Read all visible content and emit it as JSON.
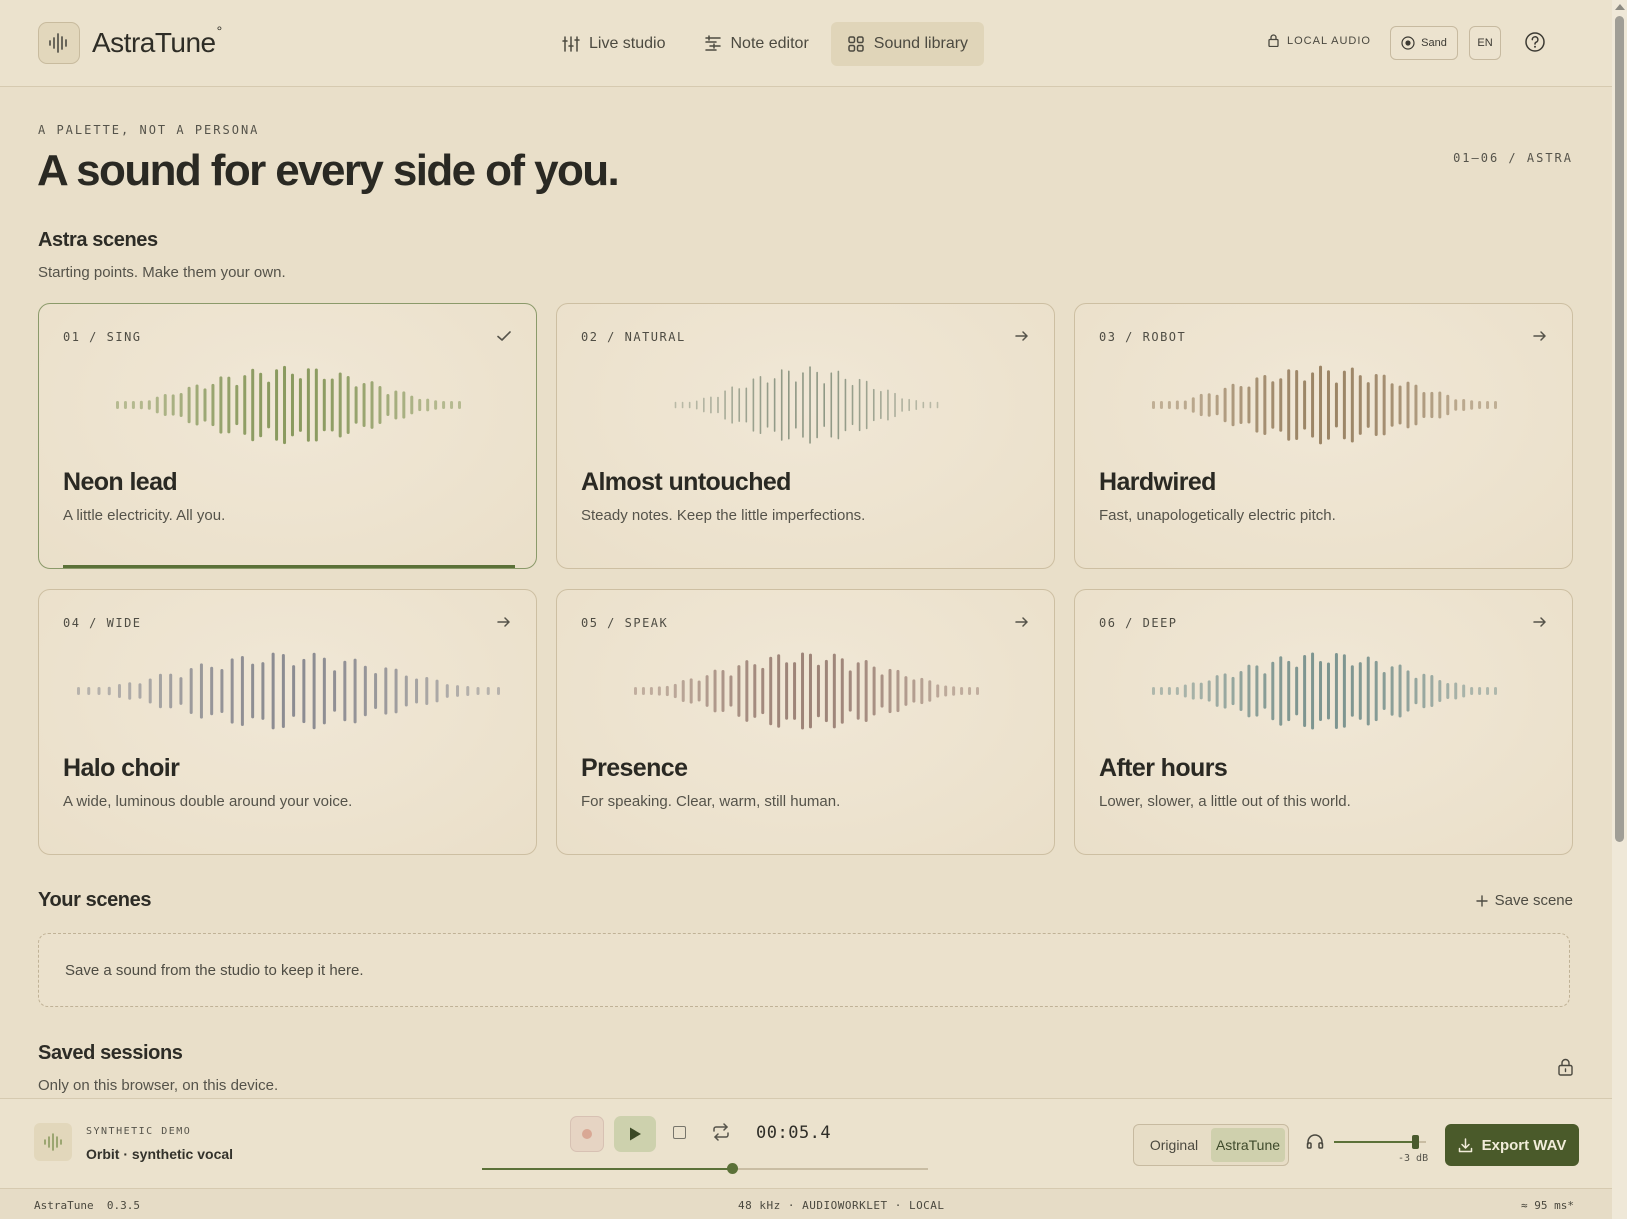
{
  "app": {
    "name": "AstraTune",
    "name_mark": "°"
  },
  "nav": [
    {
      "label": "Live studio",
      "icon": "sliders-icon",
      "active": false
    },
    {
      "label": "Note editor",
      "icon": "note-list-icon",
      "active": false
    },
    {
      "label": "Sound library",
      "icon": "grid-icon",
      "active": true
    }
  ],
  "topbar": {
    "local_audio": "LOCAL AUDIO",
    "theme_label": "Sand",
    "lang_label": "EN"
  },
  "hero": {
    "eyebrow": "A PALETTE, NOT A PERSONA",
    "title": "A sound for every side of you.",
    "index": "01—06 / ASTRA"
  },
  "astra_scenes": {
    "title": "Astra scenes",
    "subtitle": "Starting points. Make them your own."
  },
  "cards": [
    {
      "tag": "01 / SING",
      "title": "Neon lead",
      "desc": "A little electricity. All you.",
      "selected": true,
      "color": "#8a9a5f",
      "shape": 1
    },
    {
      "tag": "02 / NATURAL",
      "title": "Almost untouched",
      "desc": "Steady notes. Keep the little imperfections.",
      "selected": false,
      "color": "#8e9784",
      "shape": 2
    },
    {
      "tag": "03 / ROBOT",
      "title": "Hardwired",
      "desc": "Fast, unapologetically electric pitch.",
      "selected": false,
      "color": "#9c8566",
      "shape": 1
    },
    {
      "tag": "04 / WIDE",
      "title": "Halo choir",
      "desc": "A wide, luminous double around your voice.",
      "selected": false,
      "color": "#8c8c92",
      "shape": 3
    },
    {
      "tag": "05 / SPEAK",
      "title": "Presence",
      "desc": "For speaking. Clear, warm, still human.",
      "selected": false,
      "color": "#9e8478",
      "shape": 1
    },
    {
      "tag": "06 / DEEP",
      "title": "After hours",
      "desc": "Lower, slower, a little out of this world.",
      "selected": false,
      "color": "#7d9590",
      "shape": 1
    }
  ],
  "your_scenes": {
    "title": "Your scenes",
    "save_label": "Save scene",
    "empty": "Save a sound from the studio to keep it here."
  },
  "saved_sessions": {
    "title": "Saved sessions",
    "subtitle": "Only on this browser, on this device."
  },
  "player": {
    "source_label": "SYNTHETIC DEMO",
    "track": "Orbit · synthetic vocal",
    "time": "00:05.4",
    "progress": 0.56,
    "ab_original": "Original",
    "ab_processed": "AstraTune",
    "ab_selected": "AstraTune",
    "volume": 0.88,
    "volume_label": "-3 dB",
    "export_label": "Export WAV",
    "accent": "#4a5a2a"
  },
  "status": {
    "left": "AstraTune  0.3.5",
    "middle": "48 kHz · AUDIOWORKLET · LOCAL",
    "right": "≈ 95 ms*"
  }
}
